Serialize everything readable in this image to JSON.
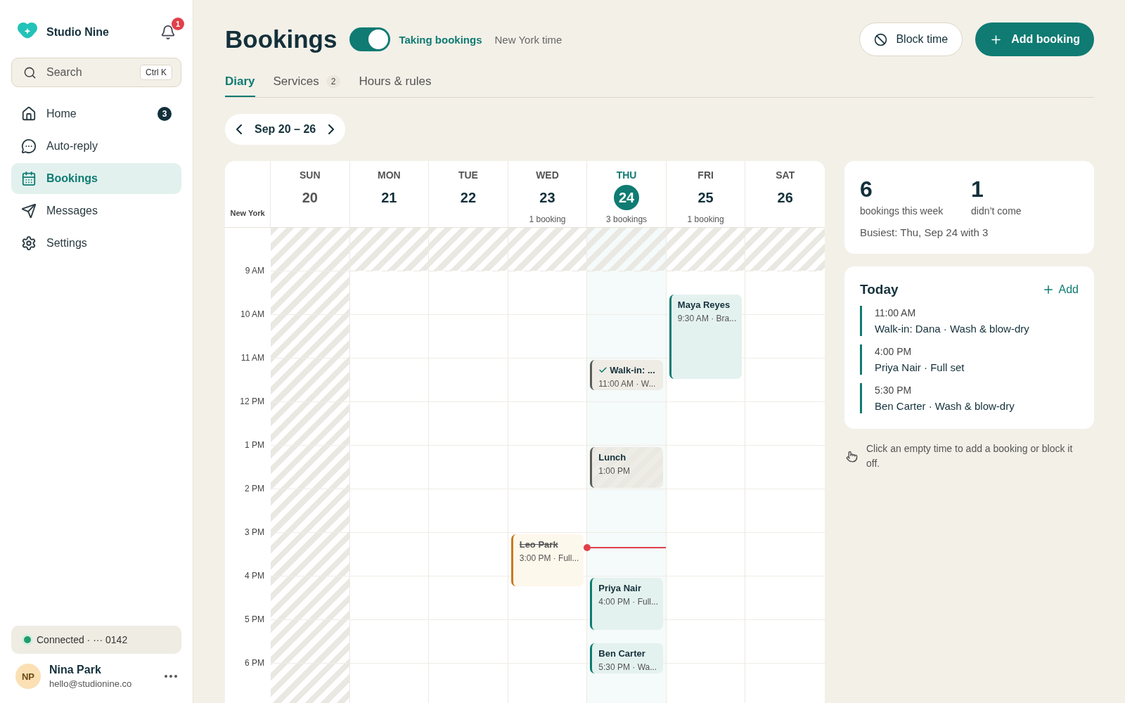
{
  "sidebar": {
    "brand": "Studio Nine",
    "notifications": "1",
    "search": {
      "placeholder": "Search",
      "shortcut": "Ctrl K"
    },
    "items": [
      {
        "label": "Home",
        "badge": "3",
        "selected": false
      },
      {
        "label": "Auto-reply",
        "selected": false
      },
      {
        "label": "Bookings",
        "selected": true
      },
      {
        "label": "Messages",
        "selected": false
      },
      {
        "label": "Settings",
        "selected": false
      }
    ],
    "connection": {
      "label": "Connected · ··· 0142",
      "color": "#1f9d6b"
    },
    "user": {
      "initials": "NP",
      "name": "Nina Park",
      "email": "hello@studionine.co"
    }
  },
  "header": {
    "title": "Bookings",
    "toggle": {
      "on": true,
      "label": "Taking bookings"
    },
    "timezone": "New York time",
    "buttons": [
      {
        "label": "Block time",
        "kind": "secondary"
      },
      {
        "label": "Add booking",
        "kind": "primary"
      }
    ]
  },
  "tabs": [
    {
      "label": "Diary",
      "selected": true
    },
    {
      "label": "Services",
      "badge": "2",
      "selected": false
    },
    {
      "label": "Hours & rules",
      "selected": false
    }
  ],
  "range": "Sep 20 – 26",
  "calendar": {
    "zone": "New York",
    "rows": [
      {
        "closed": true
      },
      {
        "label": "9 AM",
        "closed": false
      },
      {
        "label": "10 AM",
        "closed": false
      },
      {
        "label": "11 AM",
        "closed": false
      },
      {
        "label": "12 PM",
        "closed": false
      },
      {
        "label": "1 PM",
        "closed": false
      },
      {
        "label": "2 PM",
        "closed": false
      },
      {
        "label": "3 PM",
        "closed": false
      },
      {
        "label": "4 PM",
        "closed": false
      },
      {
        "label": "5 PM",
        "closed": false
      },
      {
        "label": "6 PM",
        "closed": false
      }
    ],
    "days": [
      {
        "name": "SUN",
        "date": "20",
        "closed": true,
        "selected": false
      },
      {
        "name": "MON",
        "date": "21",
        "closed": false,
        "selected": false
      },
      {
        "name": "TUE",
        "date": "22",
        "closed": false,
        "selected": false
      },
      {
        "name": "WED",
        "date": "23",
        "count": "1 booking",
        "closed": false,
        "selected": false,
        "events": [
          {
            "kind": "cancelled",
            "title": "Leo Park",
            "detail": "3:00 PM · Full..."
          }
        ]
      },
      {
        "name": "THU",
        "date": "24",
        "count": "3 bookings",
        "closed": false,
        "selected": true,
        "events": [
          {
            "kind": "arrived",
            "title": "Walk-in: ...",
            "detail": "11:00 AM · W..."
          },
          {
            "kind": "blocked",
            "title": "Lunch",
            "detail": "1:00 PM"
          },
          {
            "kind": "booking",
            "title": "Priya Nair",
            "detail": "4:00 PM · Full..."
          },
          {
            "kind": "booking",
            "title": "Ben Carter",
            "detail": "5:30 PM · Wa..."
          }
        ]
      },
      {
        "name": "FRI",
        "date": "25",
        "count": "1 booking",
        "closed": false,
        "selected": false,
        "events": [
          {
            "kind": "booking",
            "title": "Maya Reyes",
            "detail": "9:30 AM · Bra..."
          }
        ]
      },
      {
        "name": "SAT",
        "date": "26",
        "closed": false,
        "selected": false
      }
    ]
  },
  "stats": {
    "items": [
      {
        "value": "6",
        "label": "bookings this week"
      },
      {
        "value": "1",
        "label": "didn’t come"
      }
    ],
    "note": "Busiest: Thu, Sep 24 with 3"
  },
  "today": {
    "title": "Today",
    "action": "Add",
    "items": [
      {
        "time": "11:00 AM",
        "text": "Walk-in: Dana · Wash & blow-dry"
      },
      {
        "time": "4:00 PM",
        "text": "Priya Nair · Full set"
      },
      {
        "time": "5:30 PM",
        "text": "Ben Carter · Wash & blow-dry"
      }
    ]
  },
  "hint": "Click an empty time to add a booking or block it off."
}
